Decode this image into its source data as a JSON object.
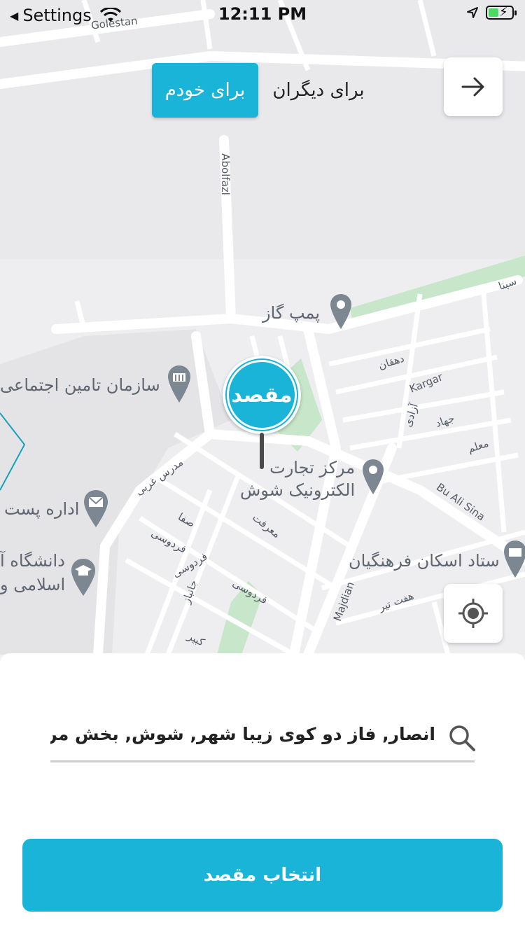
{
  "status_bar": {
    "back_label": "Settings",
    "time": "12:11 PM"
  },
  "mode_toggle": {
    "for_me": "برای خودم",
    "for_others": "برای دیگران"
  },
  "map": {
    "pin_label": "مقصد",
    "pois": {
      "gas_station": "پمپ گاز",
      "social_security": "سازمان تامین اجتماعی",
      "ecommerce_center_1": "مرکز تجارت",
      "ecommerce_center_2": "الکترونیک شوش",
      "post_office": "اداره پست",
      "university_1": "دانشگاه آ",
      "university_2": "اسلامی و",
      "teachers_housing": "ستاد اسکان فرهنگیان"
    },
    "streets": {
      "golestan": "Golestan",
      "abolfazl": "Abolfazl",
      "kargar": "Kargar",
      "bu_ali_sina": "Bu Ali Sina",
      "majdian": "Majdian",
      "sina": "سینا",
      "dehghan": "دهقان",
      "azadi": "آزادی",
      "jahad": "جهاد",
      "moalem": "معلم",
      "madres_gharbi": "مدرس غربی",
      "safa": "صفا",
      "ferdowsi_1": "فردوسی",
      "ferdowsi_2": "فردوسی",
      "ferdowsi_3": "فردوسی",
      "marefat": "معرفت",
      "janbaz": "جانباز",
      "haft_tir": "هفت تیر",
      "kabir": "کبیر"
    }
  },
  "search": {
    "value": "انصار, فاز دو کوی زیبا شهر, شوش, بخش مرکزی, شهرستان شوش"
  },
  "submit_label": "انتخاب مقصد",
  "colors": {
    "accent": "#19b4d7",
    "park_green": "#c8e6c9",
    "poi_marker": "#7d8791"
  },
  "icons": {
    "back": "arrow-right-icon",
    "locate": "crosshair-icon",
    "search": "search-icon"
  }
}
